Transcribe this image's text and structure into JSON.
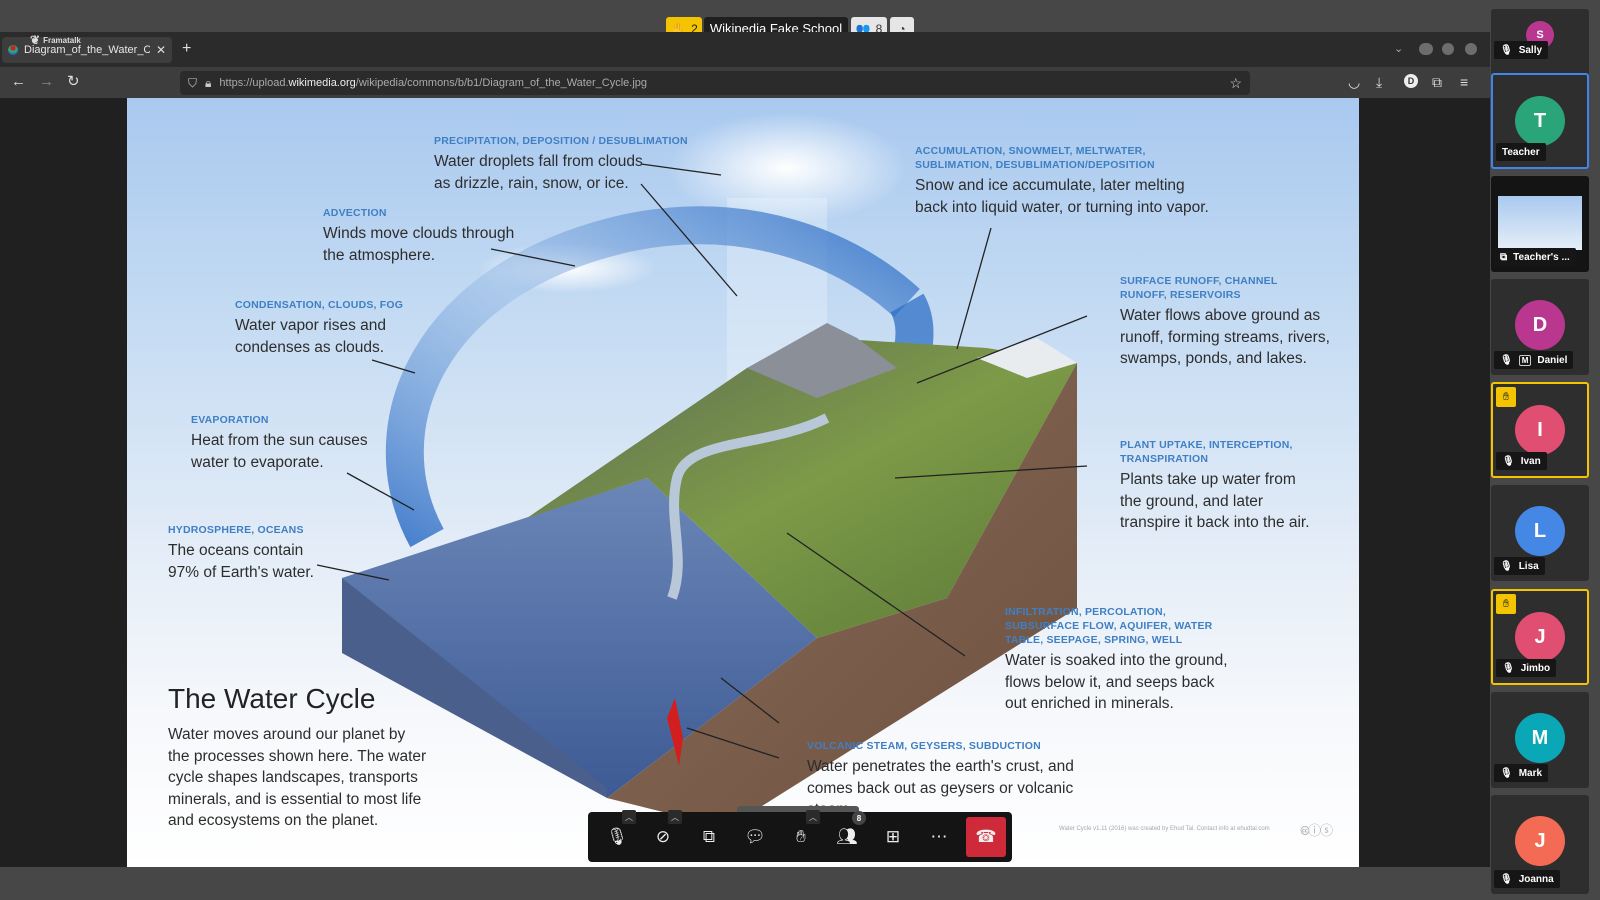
{
  "conference": {
    "raised_hands_count": "2",
    "room_title": "Wikipedia Fake School",
    "participants_count": "8",
    "icons": {
      "raised_hand": "raised-hand-icon",
      "participants": "participants-icon",
      "speed": "speedometer-icon"
    }
  },
  "browser": {
    "tab": {
      "title": "Diagram_of_the_Water_Cyc",
      "overlay_label": "Framatalk"
    },
    "url": {
      "prefix": "https://upload.",
      "domain": "wikimedia.org",
      "path": "/wikipedia/commons/b/b1/Diagram_of_the_Water_Cycle.jpg"
    },
    "profile_initial": "D"
  },
  "poster": {
    "title": "The Water Cycle",
    "body": "Water moves around our planet by the processes shown here. The water cycle shapes landscapes, transports minerals, and is essential to most life and ecosystems on the planet.",
    "credit": "Water Cycle v1.11 (2016) was created by Ehud Tal. Contact info at ehudtal.com",
    "license": "CC BY SA",
    "callouts": [
      {
        "category": "Precipitation, Deposition / Desublimation",
        "text": "Water droplets fall from clouds as drizzle, rain, snow, or ice."
      },
      {
        "category": "Advection",
        "text": "Winds move clouds through the atmosphere."
      },
      {
        "category": "Condensation, Clouds, Fog",
        "text": "Water vapor rises and condenses as clouds."
      },
      {
        "category": "Evaporation",
        "text": "Heat from the sun causes water to evaporate."
      },
      {
        "category": "Hydrosphere, Oceans",
        "text": "The oceans contain 97% of Earth's water."
      },
      {
        "category": "Accumulation, Snowmelt, Meltwater, Sublimation, Desublimation/Deposition",
        "text": "Snow and ice accumulate, later melting back into liquid water, or turning into vapor."
      },
      {
        "category": "Surface Runoff, Channel Runoff, Reservoirs",
        "text": "Water flows above ground as runoff, forming streams, rivers, swamps, ponds, and lakes."
      },
      {
        "category": "Plant Uptake, Interception, Transpiration",
        "text": "Plants take up water from the ground, and later transpire it back into the air."
      },
      {
        "category": "Infiltration, Percolation, Subsurface Flow, Aquifer, Water Table, Seepage, Spring, Well",
        "text": "Water is soaked into the ground, flows below it, and seeps back out enriched in minerals."
      },
      {
        "category": "Volcanic Steam, Geysers, Subduction",
        "text": "Water penetrates the earth's crust, and comes back out as geysers or volcanic steam"
      }
    ]
  },
  "toolbar": {
    "participants_badge": "8",
    "buttons": [
      "microphone-muted",
      "camera-off",
      "screen-share",
      "chat",
      "raise-hand",
      "participants",
      "tile-view",
      "more-actions",
      "hang-up"
    ]
  },
  "participants": [
    {
      "name": "Sally",
      "initial": "S",
      "color": "#b9378f",
      "muted": true
    },
    {
      "name": "Teacher",
      "initial": "T",
      "color": "#2aa57a",
      "speaking": true
    },
    {
      "name": "Teacher's ...",
      "screen_share": true
    },
    {
      "name": "Daniel",
      "initial": "D",
      "color": "#b9378f",
      "muted": true,
      "moderator_badge": "M"
    },
    {
      "name": "Ivan",
      "initial": "I",
      "color": "#e04e72",
      "muted": true,
      "hand_raised": true
    },
    {
      "name": "Lisa",
      "initial": "L",
      "color": "#4487e4",
      "muted": true
    },
    {
      "name": "Jimbo",
      "initial": "J",
      "color": "#e04e72",
      "muted": true,
      "hand_raised": true
    },
    {
      "name": "Mark",
      "initial": "M",
      "color": "#0aa8b6",
      "muted": true
    },
    {
      "name": "Joanna",
      "initial": "J",
      "color": "#f36a55",
      "muted": true
    }
  ]
}
